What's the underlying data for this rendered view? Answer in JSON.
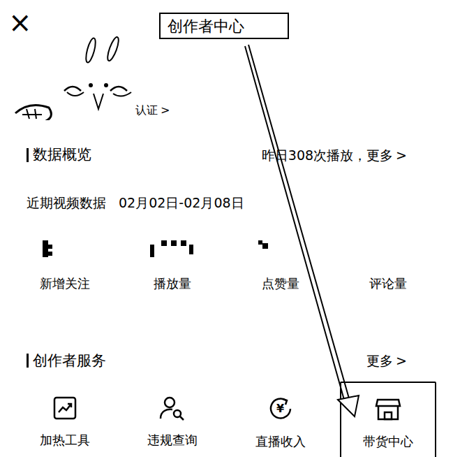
{
  "close": "×",
  "annotation": {
    "label": "创作者中心"
  },
  "profile": {
    "verify_link": "认证",
    "chevron": ">"
  },
  "overview": {
    "title": "数据概览",
    "summary": "昨日308次播放，更多",
    "chevron": ">"
  },
  "recent": {
    "label": "近期视频数据",
    "range": "02月02日-02月08日"
  },
  "stats": [
    {
      "label": "新增关注"
    },
    {
      "label": "播放量"
    },
    {
      "label": "点赞量"
    },
    {
      "label": "评论量"
    }
  ],
  "services": {
    "title": "创作者服务",
    "more": "更多",
    "chevron": ">",
    "items": [
      {
        "label": "加热工具",
        "kind": "chart",
        "selected": false
      },
      {
        "label": "违规查询",
        "kind": "search-user",
        "selected": false
      },
      {
        "label": "直播收入",
        "kind": "income",
        "icon_glyph": "¥",
        "selected": false
      },
      {
        "label": "带货中心",
        "kind": "shop",
        "selected": true
      }
    ]
  }
}
